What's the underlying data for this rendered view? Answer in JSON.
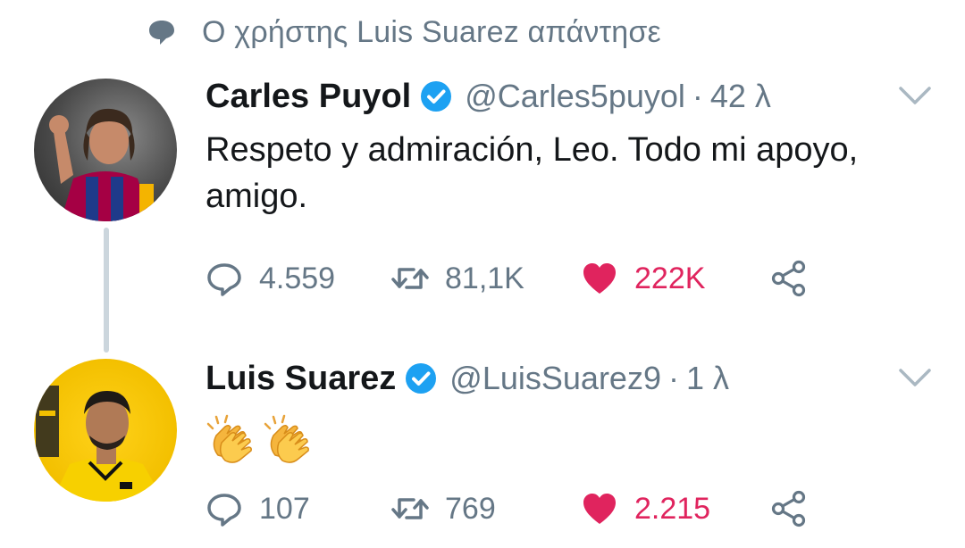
{
  "context": {
    "text": "Ο χρήστης Luis Suarez απάντησε",
    "icon": "speech-bubble-icon"
  },
  "colors": {
    "like": "#e0245e",
    "secondary": "#657786",
    "verified": "#1da1f2",
    "thread_line": "#ccd6dd"
  },
  "tweets": [
    {
      "display_name": "Carles Puyol",
      "handle": "@Carles5puyol",
      "separator": "·",
      "time": "42 λ",
      "text": "Respeto y admiración, Leo. Todo mi apoyo, amigo.",
      "stats": {
        "replies": "4.559",
        "retweets": "81,1K",
        "likes": "222K"
      },
      "liked": true
    },
    {
      "display_name": "Luis Suarez",
      "handle": "@LuisSuarez9",
      "separator": "·",
      "time": "1 λ",
      "text_emoji": [
        "clapping-hands",
        "clapping-hands"
      ],
      "stats": {
        "replies": "107",
        "retweets": "769",
        "likes": "2.215"
      },
      "liked": true
    }
  ]
}
